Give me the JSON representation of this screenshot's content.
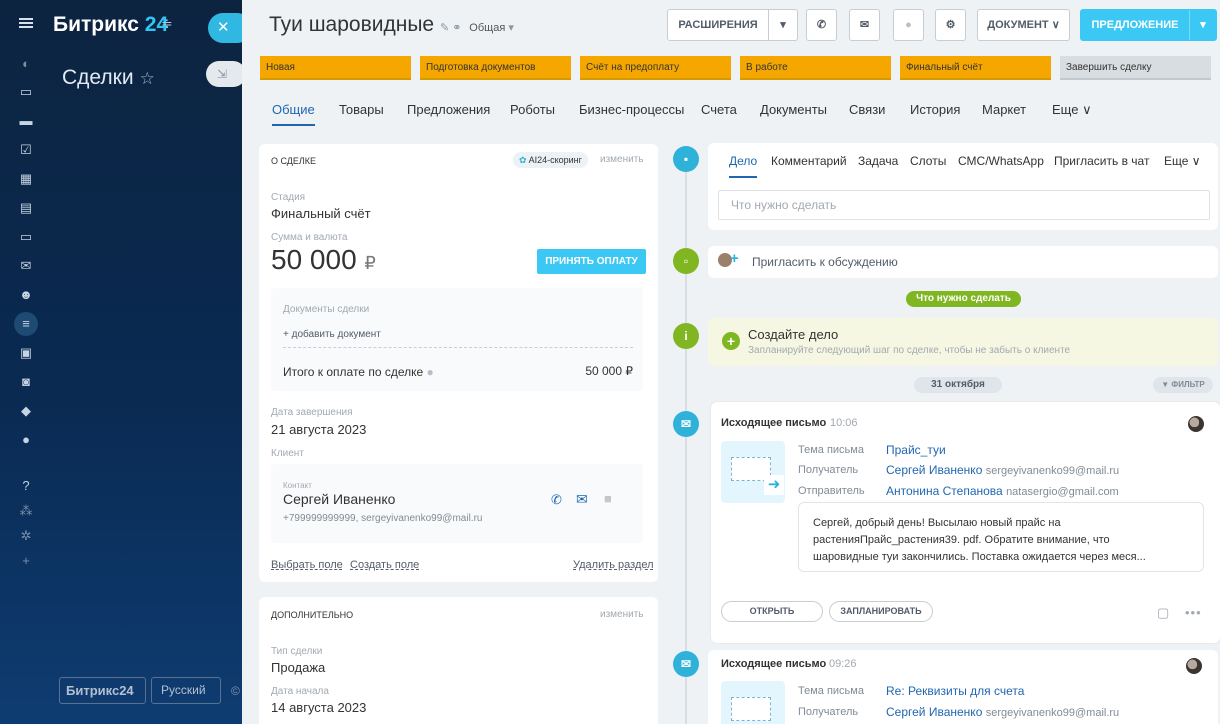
{
  "left": {
    "logo": "Битрикс",
    "logo_num": "24",
    "section_title": "Сделки",
    "footer_logo": "Битрикс24",
    "footer_lang": "Русский",
    "footer_copy": "©",
    "rail_icons": [
      "menu-icon",
      "activity-icon",
      "tasks-icon",
      "chat-icon",
      "checklist-icon",
      "calendar-icon",
      "document-icon",
      "drive-icon",
      "mail-icon",
      "group-icon",
      "crm-icon",
      "contact-card-icon",
      "robot-icon",
      "box-icon",
      "chevron-circle-icon",
      "help-icon",
      "sitemap-icon",
      "settings-icon",
      "plus-icon"
    ]
  },
  "header": {
    "title": "Туи шаровидные",
    "category": "Общая",
    "ext_button": "РАСШИРЕНИЯ",
    "document_button": "ДОКУМЕНТ",
    "offer_button": "ПРЕДЛОЖЕНИЕ"
  },
  "stages": [
    "Новая",
    "Подготовка документов",
    "Счёт на предоплату",
    "В работе",
    "Финальный счёт",
    "Завершить сделку"
  ],
  "tabs": [
    "Общие",
    "Товары",
    "Предложения",
    "Роботы",
    "Бизнес-процессы",
    "Счета",
    "Документы",
    "Связи",
    "История",
    "Маркет",
    "Еще"
  ],
  "about": {
    "section": "О СДЕЛКЕ",
    "ai_badge": "AI24-скоринг",
    "change": "изменить",
    "stage_label": "Стадия",
    "stage_value": "Финальный счёт",
    "sum_label": "Сумма и валюта",
    "sum_value": "50 000",
    "currency": "₽",
    "pay_button": "ПРИНЯТЬ ОПЛАТУ",
    "docs_label": "Документы сделки",
    "add_doc": "+ добавить документ",
    "total_label": "Итого к оплате по сделке",
    "total_value": "50 000 ₽",
    "close_label": "Дата завершения",
    "close_value": "21 августа 2023",
    "client_label": "Клиент",
    "contact_label": "Контакт",
    "contact_name": "Сергей Иваненко",
    "contact_info": "+799999999999, sergeyivanenko99@mail.ru",
    "choose_field": "Выбрать поле",
    "create_field": "Создать поле",
    "delete_section": "Удалить раздел"
  },
  "extra": {
    "section": "ДОПОЛНИТЕЛЬНО",
    "change": "изменить",
    "type_label": "Тип сделки",
    "type_value": "Продажа",
    "start_label": "Дата начала",
    "start_value": "14 августа 2023"
  },
  "activity": {
    "tabs": [
      "Дело",
      "Комментарий",
      "Задача",
      "Слоты",
      "СМС/WhatsApp",
      "Пригласить в чат",
      "Еще"
    ],
    "placeholder": "Что нужно сделать",
    "invite": "Пригласить к обсуждению",
    "todo_pill": "Что нужно сделать",
    "create_title": "Создайте дело",
    "create_sub": "Запланируйте следующий шаг по сделке, чтобы не забыть о клиенте",
    "date_pill": "31 октября",
    "filter": "ФИЛЬТР"
  },
  "mail1": {
    "title": "Исходящее письмо",
    "time": "10:06",
    "subject_label": "Тема письма",
    "subject": "Прайс_туи",
    "to_label": "Получатель",
    "to_name": "Сергей Иваненко",
    "to_email": "sergeyivanenko99@mail.ru",
    "from_label": "Отправитель",
    "from_name": "Антонина Степанова",
    "from_email": "natasergio@gmail.com",
    "body_1": "Сергей, добрый день! Высылаю новый прайс на",
    "body_2": "растенияПрайс_растения39. pdf. Обратите внимание, что",
    "body_3": "шаровидные туи закончились. Поставка ожидается через меся...",
    "open": "ОТКРЫТЬ",
    "plan": "ЗАПЛАНИРОВАТЬ"
  },
  "mail2": {
    "title": "Исходящее письмо",
    "time": "09:26",
    "subject_label": "Тема письма",
    "subject": "Re: Реквизиты для счета",
    "to_label": "Получатель",
    "to_name": "Сергей Иваненко",
    "to_email": "sergeyivanenko99@mail.ru"
  }
}
